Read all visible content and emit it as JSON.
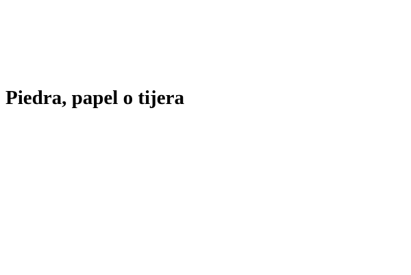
{
  "page": {
    "title": "Piedra, papel o tijera",
    "background_color": "#ffffff",
    "text_color": "#000000"
  }
}
